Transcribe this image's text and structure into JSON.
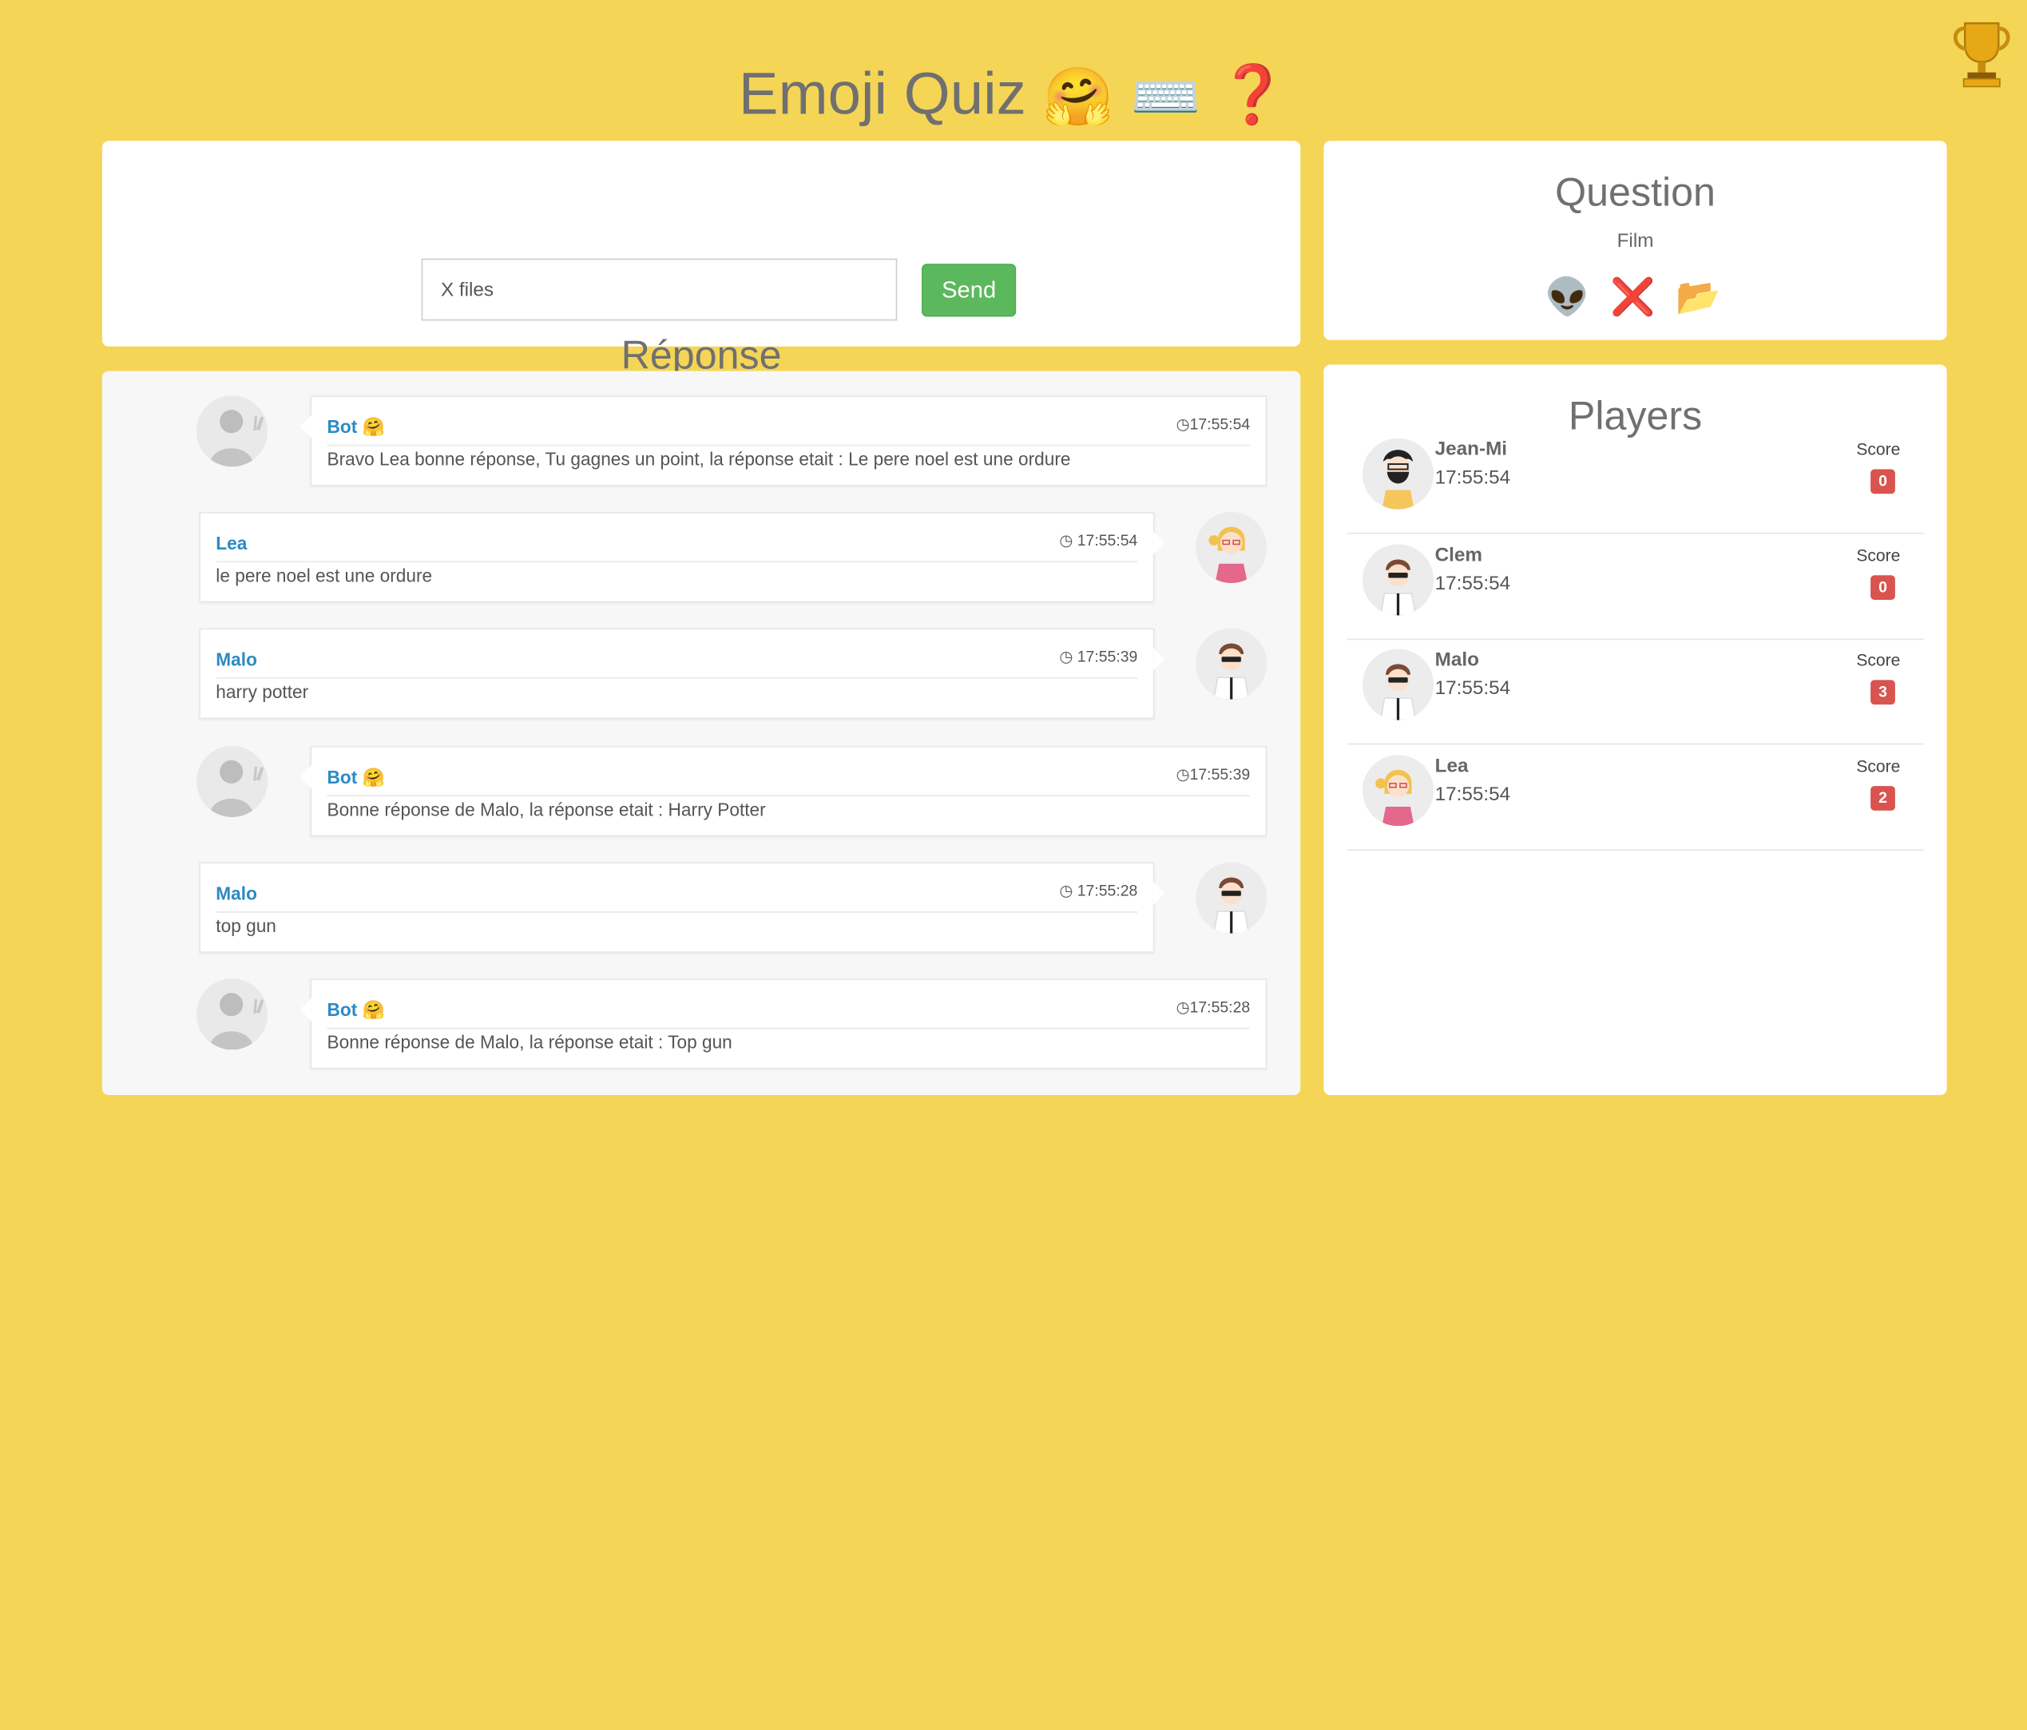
{
  "header": {
    "title": "Emoji Quiz",
    "title_emojis": [
      "🤗",
      "⌨️",
      "❓"
    ],
    "trophy_icon": "trophy-icon"
  },
  "answer": {
    "heading": "Réponse",
    "input_value": "X files",
    "send_label": "Send"
  },
  "question": {
    "heading": "Question",
    "category": "Film",
    "emojis": [
      "👽",
      "❌",
      "📂"
    ]
  },
  "chat": {
    "messages": [
      {
        "name": "Bot 🤗",
        "time": "17:55:54",
        "text": "Bravo Lea bonne réponse, Tu gagnes un point, la réponse etait : Le pere noel est une ordure",
        "side": "left",
        "avatar": "bot"
      },
      {
        "name": "Lea",
        "time": "17:55:54",
        "text": "le pere noel est une ordure",
        "side": "right",
        "avatar": "lea"
      },
      {
        "name": "Malo",
        "time": "17:55:39",
        "text": "harry potter",
        "side": "right",
        "avatar": "malo"
      },
      {
        "name": "Bot 🤗",
        "time": "17:55:39",
        "text": "Bonne réponse de Malo, la réponse etait : Harry Potter",
        "side": "left",
        "avatar": "bot"
      },
      {
        "name": "Malo",
        "time": "17:55:28",
        "text": "top gun",
        "side": "right",
        "avatar": "malo"
      },
      {
        "name": "Bot 🤗",
        "time": "17:55:28",
        "text": "Bonne réponse de Malo, la réponse etait : Top gun",
        "side": "left",
        "avatar": "bot"
      }
    ]
  },
  "players": {
    "heading": "Players",
    "list": [
      {
        "name": "Jean-Mi",
        "time": "17:55:54",
        "score_label": "Score",
        "score": "0"
      },
      {
        "name": "Clem",
        "time": "17:55:54",
        "score_label": "Score",
        "score": "0"
      },
      {
        "name": "Malo",
        "time": "17:55:54",
        "score_label": "Score",
        "score": "3"
      },
      {
        "name": "Lea",
        "time": "17:55:54",
        "score_label": "Score",
        "score": "2"
      }
    ]
  },
  "colors": {
    "background": "#f5d556",
    "send_button": "#5cb85c",
    "name_link": "#2a8bc4",
    "score_badge": "#d9534f"
  }
}
